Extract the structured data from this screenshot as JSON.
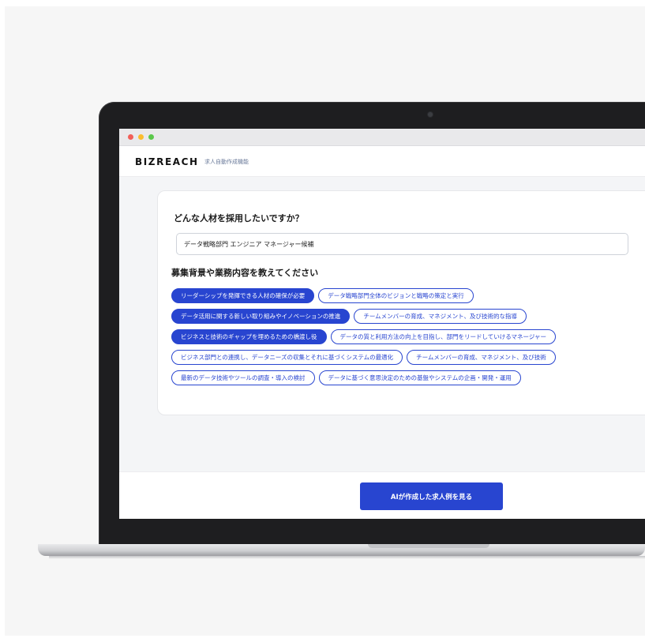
{
  "window": {
    "controls": [
      "close",
      "minimize",
      "maximize"
    ]
  },
  "header": {
    "logo": "BIZREACH",
    "subtitle": "求人自動作成機能"
  },
  "form": {
    "question1": "どんな人材を採用したいですか？",
    "job_title_value": "データ戦略部門 エンジニア マネージャー候補",
    "question2": "募集背景や業務内容を教えてください",
    "chip_rows": [
      [
        {
          "label": "リーダーシップを発揮できる人材の確保が必要",
          "selected": true
        },
        {
          "label": "データ戦略部門全体のビジョンと戦略の策定と実行",
          "selected": false
        }
      ],
      [
        {
          "label": "データ活用に関する新しい取り組みやイノベーションの推進",
          "selected": true
        },
        {
          "label": "チームメンバーの育成、マネジメント、及び技術的な指導",
          "selected": false
        }
      ],
      [
        {
          "label": "ビジネスと技術のギャップを埋めるための橋渡し役",
          "selected": true
        },
        {
          "label": "データの質と利用方法の向上を目指し、部門をリードしていけるマネージャー",
          "selected": false
        }
      ],
      [
        {
          "label": "ビジネス部門との連携し、データニーズの収集とそれに基づくシステムの最適化",
          "selected": false
        },
        {
          "label": "チームメンバーの育成、マネジメント、及び技術",
          "selected": false
        }
      ],
      [
        {
          "label": "最新のデータ技術やツールの調査・導入の検討",
          "selected": false
        },
        {
          "label": "データに基づく意思決定のための基盤やシステムの企画・開発・運用",
          "selected": false
        }
      ]
    ]
  },
  "footer": {
    "cta_label": "AIが作成した求人例を見る"
  },
  "colors": {
    "accent": "#2845d0",
    "bezel": "#1e1e20",
    "screen_bg": "#f4f5f7"
  }
}
